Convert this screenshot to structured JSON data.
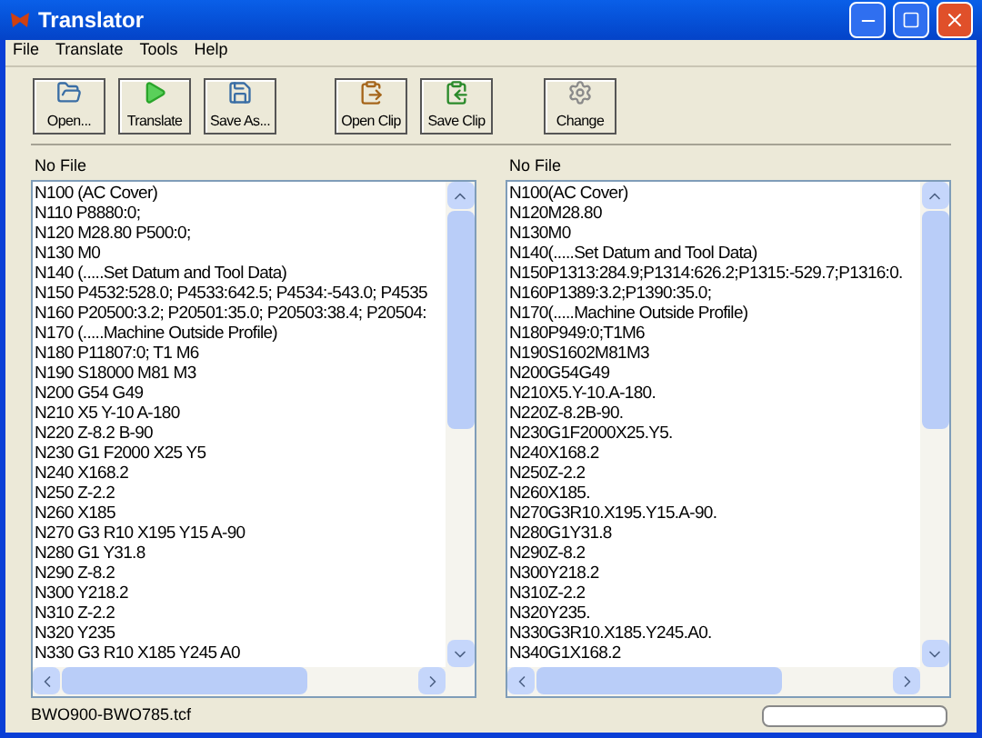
{
  "window": {
    "title": "Translator"
  },
  "menu": [
    "File",
    "Translate",
    "Tools",
    "Help"
  ],
  "toolbar": [
    {
      "label": "Open...",
      "kind": "open"
    },
    {
      "label": "Translate",
      "kind": "translate"
    },
    {
      "label": "Save As...",
      "kind": "save"
    },
    {
      "label": "Open Clip",
      "kind": "openclip"
    },
    {
      "label": "Save Clip",
      "kind": "saveclip"
    },
    {
      "label": "Change",
      "kind": "change"
    }
  ],
  "panels": [
    {
      "label": "No File",
      "lines": [
        "N100 (AC Cover)",
        "N110 P8880:0;",
        "N120 M28.80 P500:0;",
        "N130 M0",
        "N140 (.....Set Datum and Tool Data)",
        "N150 P4532:528.0; P4533:642.5; P4534:-543.0; P4535",
        "N160 P20500:3.2; P20501:35.0; P20503:38.4; P20504:",
        "N170 (.....Machine Outside Profile)",
        "N180 P11807:0; T1 M6",
        "N190 S18000 M81 M3",
        "N200 G54 G49",
        "N210 X5 Y-10 A-180",
        "N220 Z-8.2 B-90",
        "N230 G1 F2000 X25 Y5",
        "N240 X168.2",
        "N250 Z-2.2",
        "N260 X185",
        "N270 G3 R10 X195 Y15 A-90",
        "N280 G1 Y31.8",
        "N290 Z-8.2",
        "N300 Y218.2",
        "N310 Z-2.2",
        "N320 Y235",
        "N330 G3 R10 X185 Y245 A0"
      ]
    },
    {
      "label": "No File",
      "lines": [
        "N100(AC Cover)",
        "N120M28.80",
        "N130M0",
        "N140(.....Set Datum and Tool Data)",
        "N150P1313:284.9;P1314:626.2;P1315:-529.7;P1316:0.",
        "N160P1389:3.2;P1390:35.0;",
        "N170(.....Machine Outside Profile)",
        "N180P949:0;T1M6",
        "N190S1602M81M3",
        "N200G54G49",
        "N210X5.Y-10.A-180.",
        "N220Z-8.2B-90.",
        "N230G1F2000X25.Y5.",
        "N240X168.2",
        "N250Z-2.2",
        "N260X185.",
        "N270G3R10.X195.Y15.A-90.",
        "N280G1Y31.8",
        "N290Z-8.2",
        "N300Y218.2",
        "N310Z-2.2",
        "N320Y235.",
        "N330G3R10.X185.Y245.A0.",
        "N340G1X168.2"
      ]
    }
  ],
  "status_bar": {
    "file": "BWO900-BWO785.tcf",
    "progress": {
      "level": 0
    }
  }
}
